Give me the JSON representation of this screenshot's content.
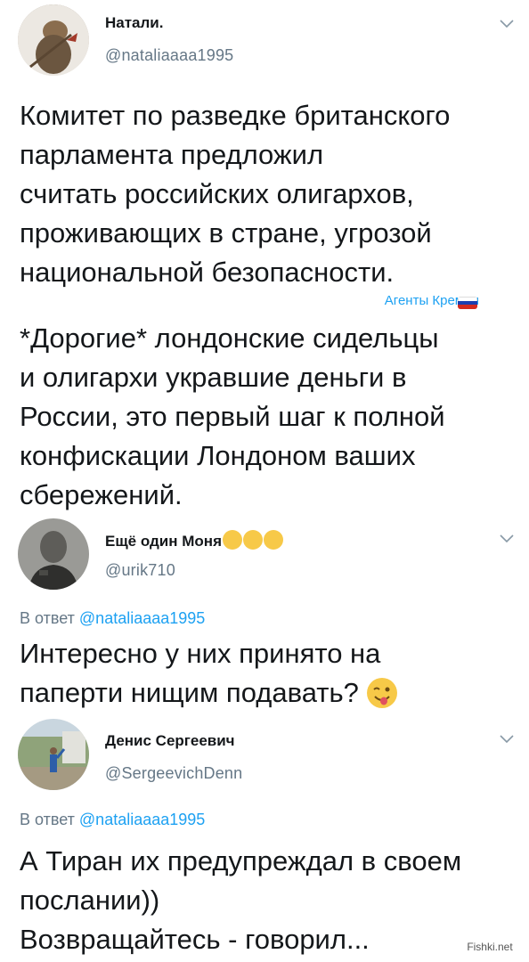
{
  "tweets": [
    {
      "name": "Натали.",
      "handle": "@nataliaaaa1995",
      "lines": [
        "Комитет по разведке британского",
        "парламента предложил",
        "считать российских олигархов,",
        "проживающих в стране, угрозой",
        "национальной безопасности."
      ],
      "tag": "Агенты Кремля",
      "lines2": [
        "*Дорогие* лондонские сидельцы",
        "и олигархи укравшие деньги в",
        "России, это первый шаг к полной",
        "конфискации Лондоном ваших",
        "сбережений."
      ]
    },
    {
      "name": "Ещё один Моня",
      "handle": "@urik710",
      "reply_prefix": "В ответ",
      "reply_handle": "@nataliaaaa1995",
      "lines": [
        "Интересно у них принято на",
        "паперти нищим подавать?"
      ]
    },
    {
      "name": "Денис Сергеевич",
      "handle": "@SergeevichDenn",
      "reply_prefix": "В ответ",
      "reply_handle": "@nataliaaaa1995",
      "lines": [
        "А Тиран их предупреждал в своем",
        "послании))",
        "Возвращайтесь - говорил..."
      ]
    }
  ],
  "watermark": "Fishki.net",
  "colors": {
    "text": "#14171a",
    "secondary": "#657786",
    "link": "#1da1f2"
  },
  "icons": [
    "chevron-down-icon",
    "tears-of-joy-emoji",
    "winking-tongue-emoji",
    "russia-flag-emoji"
  ]
}
